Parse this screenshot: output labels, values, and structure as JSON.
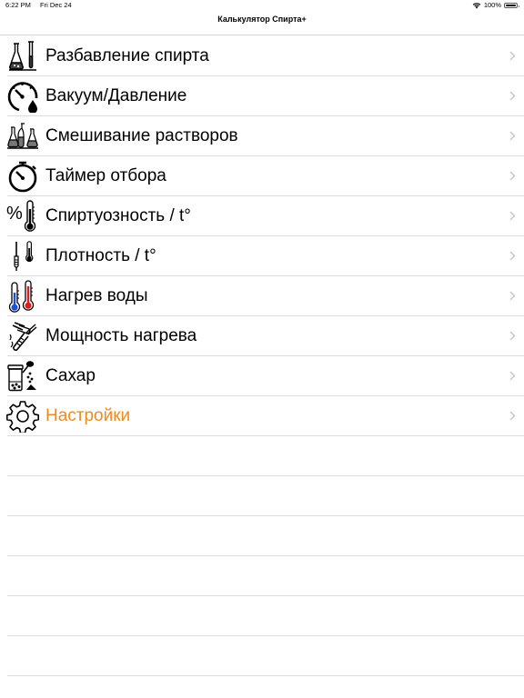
{
  "status": {
    "time": "6:22 PM",
    "date": "Fri Dec 24",
    "battery": "100%"
  },
  "nav": {
    "title": "Калькулятор Спирта+"
  },
  "menu": [
    {
      "label": "Разбавление спирта",
      "icon": "flask-icon"
    },
    {
      "label": "Вакуум/Давление",
      "icon": "pressure-gauge-icon"
    },
    {
      "label": "Смешивание растворов",
      "icon": "mixing-flasks-icon"
    },
    {
      "label": "Таймер отбора",
      "icon": "stopwatch-icon"
    },
    {
      "label": "Спиртуозность / t°",
      "icon": "alcohol-thermometer-icon"
    },
    {
      "label": "Плотность / t°",
      "icon": "hydrometer-icon"
    },
    {
      "label": "Нагрев воды",
      "icon": "hot-cold-thermometer-icon"
    },
    {
      "label": "Мощность нагрева",
      "icon": "heating-element-icon"
    },
    {
      "label": "Сахар",
      "icon": "sugar-jar-icon"
    },
    {
      "label": "Настройки",
      "icon": "gear-icon",
      "accent_color": "#ef8a1d"
    }
  ]
}
